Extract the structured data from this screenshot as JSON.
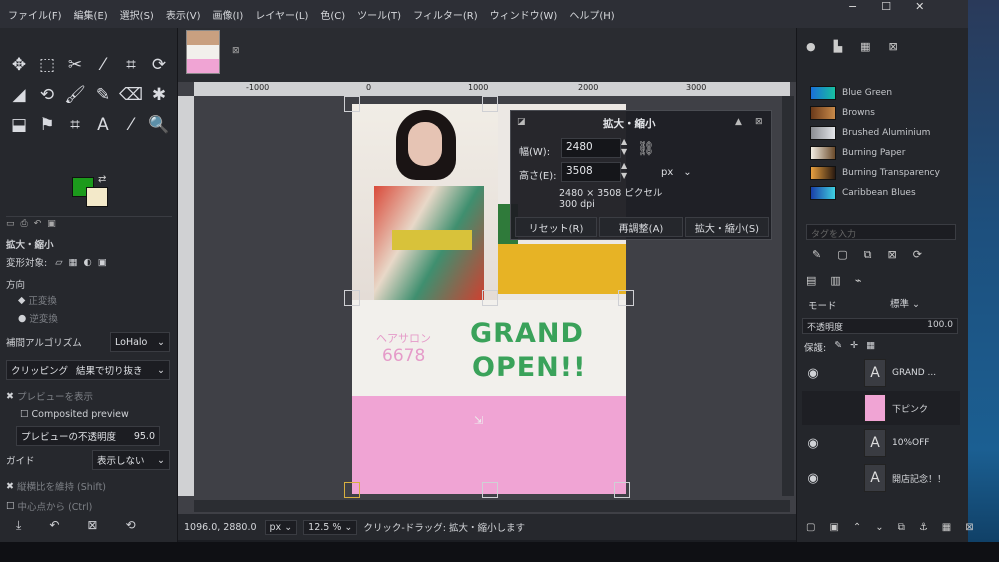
{
  "menubar": [
    "ファイル(F)",
    "編集(E)",
    "選択(S)",
    "表示(V)",
    "画像(I)",
    "レイヤー(L)",
    "色(C)",
    "ツール(T)",
    "フィルター(R)",
    "ウィンドウ(W)",
    "ヘルプ(H)"
  ],
  "window_buttons": [
    "−",
    "☐",
    "✕"
  ],
  "ruler_labels": [
    "-1000",
    "0",
    "1000",
    "2000",
    "3000"
  ],
  "toolbox": {
    "tools": [
      "✥",
      "⬚",
      "✂",
      "⁄",
      "⌗",
      "⟳",
      "◢",
      "⟲",
      "🖌",
      "✎",
      "⌫",
      "✱",
      "⬓",
      "⚑",
      "⌗",
      "A",
      "⁄",
      "🔍"
    ],
    "tool_names": [
      "move-icon",
      "rect-select-icon",
      "scissors-icon",
      "wand-icon",
      "crop-icon",
      "rotate-icon",
      "warp-icon",
      "unified-transform-icon",
      "paintbrush-icon",
      "pencil-icon",
      "eraser-icon",
      "clone-icon",
      "bucket-fill-icon",
      "smudge-icon",
      "path-icon",
      "text-icon",
      "color-picker-icon",
      "zoom-icon"
    ],
    "options_title": "拡大・縮小",
    "transform_label": "変形対象:",
    "direction_label": "方向",
    "direction_normal": "正変換",
    "direction_reverse": "逆変換",
    "interp_label": "補間アルゴリズム",
    "interp_value": "LoHalo",
    "clipping_label": "クリッピング",
    "clipping_value": "結果で切り抜き",
    "show_preview": "プレビューを表示",
    "composited_preview": "Composited preview",
    "preview_opacity_label": "プレビューの不透明度",
    "preview_opacity_value": "95.0",
    "guide_label": "ガイド",
    "guide_value": "表示しない",
    "keep_aspect": "縦横比を維持 (Shift)",
    "from_center": "中心点から (Ctrl)"
  },
  "image": {
    "salon_label": "ヘアサロン",
    "salon_num": "6678",
    "grand": "GRAND",
    "open": "OPEN!!"
  },
  "dialog": {
    "title": "拡大・縮小",
    "width_label": "幅(W):",
    "width_value": "2480",
    "height_label": "高さ(E):",
    "height_value": "3508",
    "unit": "px",
    "size_info": "2480 × 3508 ピクセル",
    "dpi_info": "300 dpi",
    "reset": "リセット(R)",
    "readjust": "再調整(A)",
    "scale": "拡大・縮小(S)"
  },
  "gradients": [
    {
      "name": "Blue Green",
      "c1": "#1a6fd8",
      "c2": "#18c0a0"
    },
    {
      "name": "Browns",
      "c1": "#6a3a1a",
      "c2": "#c88a4a"
    },
    {
      "name": "Brushed Aluminium",
      "c1": "#8a8c90",
      "c2": "#e4e6ea"
    },
    {
      "name": "Burning Paper",
      "c1": "#f4efe4",
      "c2": "#6a4a2a"
    },
    {
      "name": "Burning Transparency",
      "c1": "#e8a040",
      "c2": "#2a1a10"
    },
    {
      "name": "Caribbean Blues",
      "c1": "#1a3fa8",
      "c2": "#3fd0e0"
    }
  ],
  "tag_placeholder": "タグを入力",
  "layers_panel": {
    "mode_label": "モード",
    "mode_value": "標準",
    "opacity_label": "不透明度",
    "opacity_value": "100.0",
    "lock_label": "保護:",
    "layers": [
      {
        "name": "GRAND ...",
        "visible": true
      },
      {
        "name": "下ピンク",
        "visible": false
      },
      {
        "name": "10%OFF",
        "visible": true
      },
      {
        "name": "開店記念！！",
        "visible": true
      }
    ]
  },
  "status": {
    "coords": "1096.0, 2880.0",
    "unit": "px",
    "zoom": "12.5 %",
    "message": "クリック-ドラッグ: 拡大・縮小します"
  },
  "colors": {
    "fg": "#1c9a1c",
    "bg": "#f3e9c9",
    "accent": "#3aa25a",
    "pink": "#f0a4d4"
  }
}
